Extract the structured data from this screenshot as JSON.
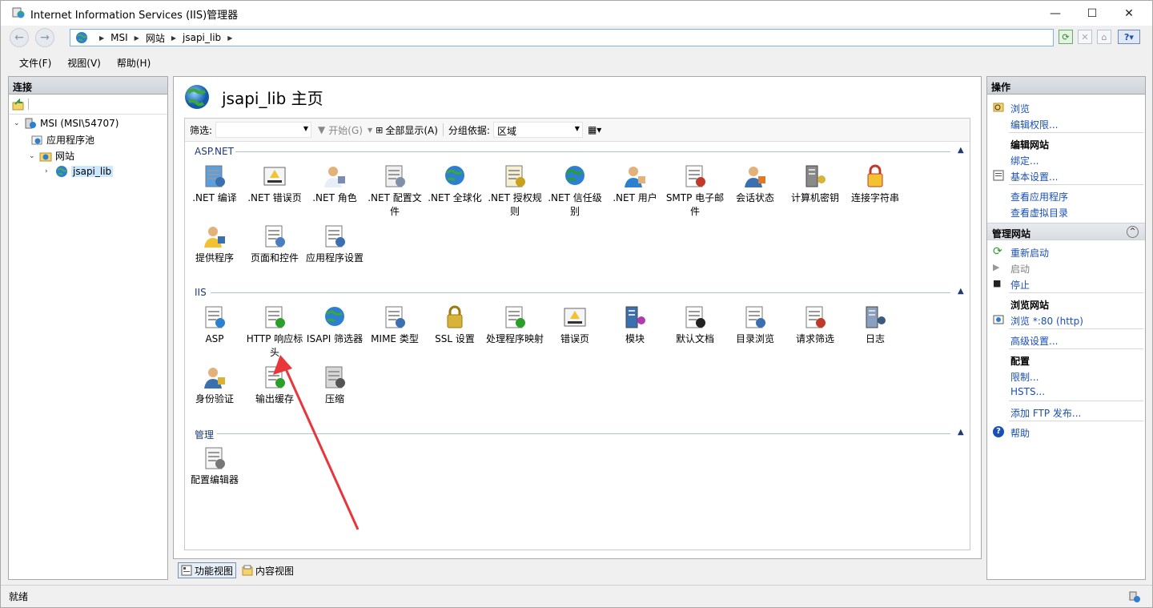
{
  "window": {
    "title": "Internet Information Services (IIS)管理器",
    "minimize": "—",
    "maximize": "☐",
    "close": "✕"
  },
  "address": {
    "crumbs": [
      "MSI",
      "网站",
      "jsapi_lib"
    ]
  },
  "menu": [
    "文件(F)",
    "视图(V)",
    "帮助(H)"
  ],
  "connections": {
    "header": "连接",
    "tree": [
      {
        "label": "MSI (MSI\\54707)",
        "level": 0,
        "expanded": true
      },
      {
        "label": "应用程序池",
        "level": 1
      },
      {
        "label": "网站",
        "level": 1,
        "expanded": true
      },
      {
        "label": "jsapi_lib",
        "level": 2,
        "selected": true
      }
    ]
  },
  "main": {
    "title": "jsapi_lib 主页",
    "filter_label": "筛选:",
    "start_label": "开始(G)",
    "showall_label": "全部显示(A)",
    "groupby_label": "分组依据:",
    "groupby_value": "区域",
    "sections": [
      {
        "name": "ASP.NET",
        "features": [
          {
            "label": ".NET 编译",
            "icon": "net-compile-icon"
          },
          {
            "label": ".NET 错误页",
            "icon": "net-error-pages-icon"
          },
          {
            "label": ".NET 角色",
            "icon": "net-roles-icon"
          },
          {
            "label": ".NET 配置文件",
            "icon": "net-profile-icon"
          },
          {
            "label": ".NET 全球化",
            "icon": "net-globalization-icon"
          },
          {
            "label": ".NET 授权规则",
            "icon": "net-authorization-icon"
          },
          {
            "label": ".NET 信任级别",
            "icon": "net-trust-levels-icon"
          },
          {
            "label": ".NET 用户",
            "icon": "net-users-icon"
          },
          {
            "label": "SMTP 电子邮件",
            "icon": "smtp-email-icon"
          },
          {
            "label": "会话状态",
            "icon": "session-state-icon"
          },
          {
            "label": "计算机密钥",
            "icon": "machine-key-icon"
          },
          {
            "label": "连接字符串",
            "icon": "connection-strings-icon"
          },
          {
            "label": "提供程序",
            "icon": "providers-icon"
          },
          {
            "label": "页面和控件",
            "icon": "pages-controls-icon"
          },
          {
            "label": "应用程序设置",
            "icon": "app-settings-icon"
          }
        ]
      },
      {
        "name": "IIS",
        "features": [
          {
            "label": "ASP",
            "icon": "asp-icon"
          },
          {
            "label": "HTTP 响应标头",
            "icon": "http-response-headers-icon"
          },
          {
            "label": "ISAPI 筛选器",
            "icon": "isapi-filters-icon"
          },
          {
            "label": "MIME 类型",
            "icon": "mime-types-icon"
          },
          {
            "label": "SSL 设置",
            "icon": "ssl-settings-icon"
          },
          {
            "label": "处理程序映射",
            "icon": "handler-mappings-icon"
          },
          {
            "label": "错误页",
            "icon": "error-pages-icon"
          },
          {
            "label": "模块",
            "icon": "modules-icon"
          },
          {
            "label": "默认文档",
            "icon": "default-document-icon"
          },
          {
            "label": "目录浏览",
            "icon": "directory-browsing-icon"
          },
          {
            "label": "请求筛选",
            "icon": "request-filtering-icon"
          },
          {
            "label": "日志",
            "icon": "logging-icon"
          },
          {
            "label": "身份验证",
            "icon": "authentication-icon"
          },
          {
            "label": "输出缓存",
            "icon": "output-caching-icon"
          },
          {
            "label": "压缩",
            "icon": "compression-icon"
          }
        ]
      },
      {
        "name": "管理",
        "features": [
          {
            "label": "配置编辑器",
            "icon": "configuration-editor-icon"
          }
        ]
      }
    ]
  },
  "view_tabs": {
    "features": "功能视图",
    "content": "内容视图"
  },
  "actions": {
    "header": "操作",
    "explore": "浏览",
    "edit_permissions": "编辑权限...",
    "edit_site_title": "编辑网站",
    "bindings": "绑定...",
    "basic_settings": "基本设置...",
    "view_applications": "查看应用程序",
    "view_virtual_dirs": "查看虚拟目录",
    "manage_site_title": "管理网站",
    "restart": "重新启动",
    "start": "启动",
    "stop": "停止",
    "browse_site_title": "浏览网站",
    "browse_80": "浏览 *:80 (http)",
    "advanced_settings": "高级设置...",
    "configure_title": "配置",
    "limits": "限制...",
    "hsts": "HSTS...",
    "add_ftp": "添加 FTP 发布...",
    "help": "帮助"
  },
  "status": {
    "text": "就绪"
  },
  "colors": {
    "link": "#1a4fb8",
    "section_text": "#1e3a78",
    "annotation_arrow": "#e8363a"
  }
}
